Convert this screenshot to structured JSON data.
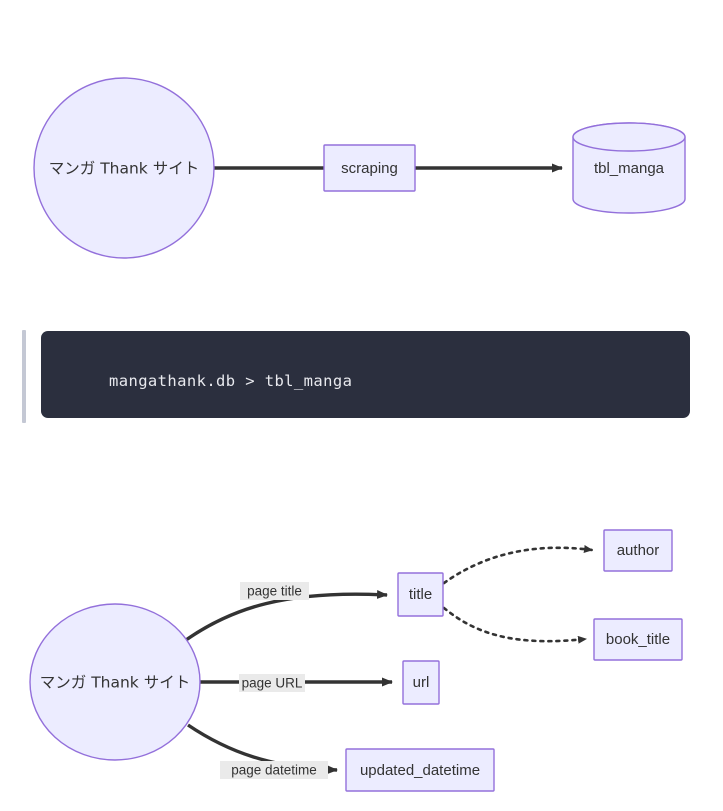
{
  "page": {
    "background_color": "#ffffff",
    "node_fill": "#ECECFF",
    "node_stroke": "#9370DB",
    "edge_color": "#333333",
    "edge_label_bg": "#eaeaea",
    "code_bg": "#2b2f3e",
    "code_text_color": "#e8e9ee",
    "quote_bar_color": "#c4c8d4"
  },
  "diagram_top": {
    "name": "scraping-overview-flowchart",
    "nodes": [
      {
        "id": "site",
        "label": "マンガ Thank サイト",
        "shape": "circle"
      },
      {
        "id": "scraping",
        "label": "scraping",
        "shape": "rect"
      },
      {
        "id": "tbl_manga",
        "label": "tbl_manga",
        "shape": "cylinder"
      }
    ],
    "edges": [
      {
        "from": "site",
        "to": "scraping",
        "style": "solid",
        "arrow": false
      },
      {
        "from": "scraping",
        "to": "tbl_manga",
        "style": "solid",
        "arrow": true
      }
    ]
  },
  "code_block": {
    "name": "db-path-code-block",
    "text": "mangathank.db > tbl_manga"
  },
  "diagram_bottom": {
    "name": "column-mapping-flowchart",
    "nodes": [
      {
        "id": "site2",
        "label": "マンガ Thank サイト",
        "shape": "circle"
      },
      {
        "id": "title",
        "label": "title",
        "shape": "rect"
      },
      {
        "id": "url",
        "label": "url",
        "shape": "rect"
      },
      {
        "id": "updated_datetime",
        "label": "updated_datetime",
        "shape": "rect"
      },
      {
        "id": "author",
        "label": "author",
        "shape": "rect"
      },
      {
        "id": "book_title",
        "label": "book_title",
        "shape": "rect"
      }
    ],
    "edges": [
      {
        "from": "site2",
        "to": "title",
        "label": "page title",
        "style": "solid",
        "arrow": true
      },
      {
        "from": "site2",
        "to": "url",
        "label": "page URL",
        "style": "solid",
        "arrow": true
      },
      {
        "from": "site2",
        "to": "updated_datetime",
        "label": "page datetime",
        "style": "solid",
        "arrow": true
      },
      {
        "from": "title",
        "to": "author",
        "label": "",
        "style": "dotted",
        "arrow": true
      },
      {
        "from": "title",
        "to": "book_title",
        "label": "",
        "style": "dotted",
        "arrow": true
      }
    ]
  }
}
